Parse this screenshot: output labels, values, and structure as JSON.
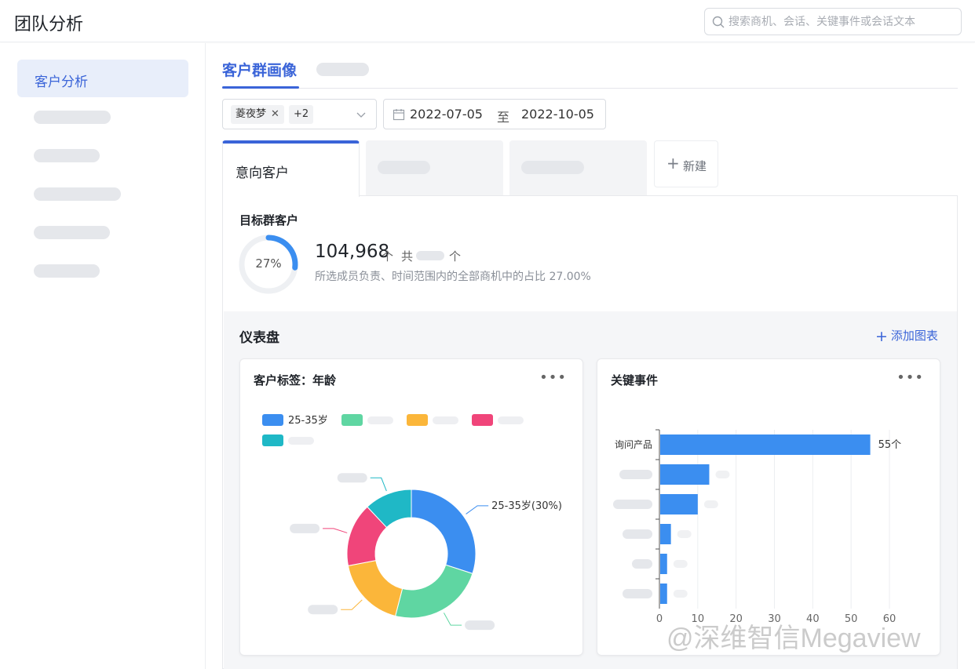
{
  "app": {
    "title": "团队分析"
  },
  "search": {
    "placeholder": "搜索商机、会话、关键事件或会话文本"
  },
  "sidebar": {
    "active_item": "客户分析"
  },
  "main": {
    "active_tab": "客户群画像"
  },
  "filters": {
    "member_chip": "菱夜梦",
    "more_chip": "+2",
    "date_start": "2022-07-05",
    "date_separator": "至",
    "date_end": "2022-10-05"
  },
  "segments": {
    "active": "意向客户",
    "new_button": "新建"
  },
  "target": {
    "title": "目标群客户",
    "percent_label": "27%",
    "percent_value": 0.27,
    "count": "104,968",
    "unit": "个",
    "total_prefix": "共",
    "description": "所选成员负责、时间范围内的全部商机中的占比 27.00%"
  },
  "dashboard": {
    "title": "仪表盘",
    "add_chart": "添加图表"
  },
  "colors": {
    "accent": "#3a64d8",
    "blue": "#3b8ef0",
    "green": "#5fd6a2",
    "yellow": "#fbb63a",
    "pink": "#f0457a",
    "teal": "#1fb8c6"
  },
  "chart_data": [
    {
      "type": "pie",
      "title": "客户标签：年龄",
      "legend": [
        "25-35岁"
      ],
      "slices": [
        {
          "label": "25-35岁",
          "value": 30,
          "color": "#3b8ef0",
          "annotation": "25-35岁(30%)"
        },
        {
          "label": "",
          "value": 24,
          "color": "#5fd6a2"
        },
        {
          "label": "",
          "value": 18,
          "color": "#fbb63a"
        },
        {
          "label": "",
          "value": 16,
          "color": "#f0457a"
        },
        {
          "label": "",
          "value": 12,
          "color": "#1fb8c6"
        }
      ]
    },
    {
      "type": "bar",
      "orientation": "horizontal",
      "title": "关键事件",
      "categories": [
        "询问产品",
        "",
        "",
        "",
        "",
        ""
      ],
      "values": [
        55,
        13,
        10,
        3,
        2,
        2
      ],
      "data_labels": [
        "55个"
      ],
      "xlim": [
        0,
        60
      ],
      "xticks": [
        0,
        10,
        20,
        30,
        40,
        50,
        60
      ],
      "grid": true
    }
  ],
  "watermark": "@深维智信Megaview"
}
